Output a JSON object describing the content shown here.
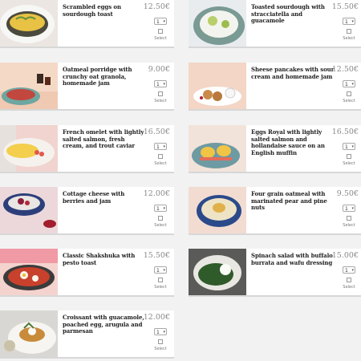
{
  "currency": "€",
  "select_label": "Select",
  "items": [
    {
      "name": "Scrambled eggs on sourdough toast",
      "price": "12.50€",
      "qty": "1"
    },
    {
      "name": "Toasted sourdough with stracciatella and guacamole",
      "price": "15.50€",
      "qty": "1"
    },
    {
      "name": "Oatmeal porridge with crunchy oat granola, homemade jam",
      "price": "9.00€",
      "qty": "1"
    },
    {
      "name": "Sheese pancakes with sour cream and homemade jam",
      "price": "12.50€",
      "qty": "1"
    },
    {
      "name": "French omelet with lightly salted salmon, fresh cream, and trout caviar",
      "price": "16.50€",
      "qty": "1"
    },
    {
      "name": "Eggs Royal with lightly salted salmon and hollandaise sauce on an English muffin",
      "price": "16.50€",
      "qty": "1"
    },
    {
      "name": "Cottage cheese with berries and jam",
      "price": "12.00€",
      "qty": "1"
    },
    {
      "name": "Four grain oatmeal with marinated pear and pine nuts",
      "price": "9.50€",
      "qty": "1"
    },
    {
      "name": "Classic Shakshuka with pesto toast",
      "price": "15.50€",
      "qty": "1"
    },
    {
      "name": "Spinach salad with buffalo burrata and wafu dressing",
      "price": "15.00€",
      "qty": "1"
    },
    {
      "name": "Croissant with guacamole, poached egg, arugula and parmesan",
      "price": "12.00€",
      "qty": "1"
    }
  ]
}
